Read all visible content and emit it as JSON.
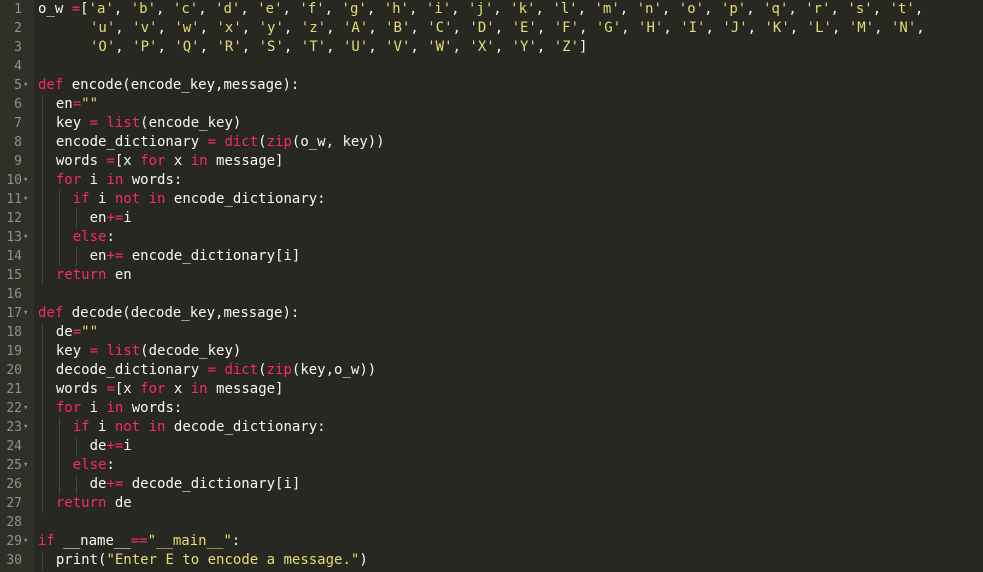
{
  "editor": {
    "theme": "monokai",
    "colors": {
      "background": "#272822",
      "gutter": "#2f3129",
      "line_number": "#8f908a",
      "text": "#f8f8f2",
      "keyword": "#f92672",
      "string": "#e6db74"
    },
    "lines": [
      {
        "n": "1",
        "fold": false,
        "indent": 0,
        "tokens": [
          [
            "o_w ",
            "plain"
          ],
          [
            "=",
            "op"
          ],
          [
            "[",
            "plain"
          ],
          [
            "'a'",
            "str"
          ],
          [
            ", ",
            "plain"
          ],
          [
            "'b'",
            "str"
          ],
          [
            ", ",
            "plain"
          ],
          [
            "'c'",
            "str"
          ],
          [
            ", ",
            "plain"
          ],
          [
            "'d'",
            "str"
          ],
          [
            ", ",
            "plain"
          ],
          [
            "'e'",
            "str"
          ],
          [
            ", ",
            "plain"
          ],
          [
            "'f'",
            "str"
          ],
          [
            ", ",
            "plain"
          ],
          [
            "'g'",
            "str"
          ],
          [
            ", ",
            "plain"
          ],
          [
            "'h'",
            "str"
          ],
          [
            ", ",
            "plain"
          ],
          [
            "'i'",
            "str"
          ],
          [
            ", ",
            "plain"
          ],
          [
            "'j'",
            "str"
          ],
          [
            ", ",
            "plain"
          ],
          [
            "'k'",
            "str"
          ],
          [
            ", ",
            "plain"
          ],
          [
            "'l'",
            "str"
          ],
          [
            ", ",
            "plain"
          ],
          [
            "'m'",
            "str"
          ],
          [
            ", ",
            "plain"
          ],
          [
            "'n'",
            "str"
          ],
          [
            ", ",
            "plain"
          ],
          [
            "'o'",
            "str"
          ],
          [
            ", ",
            "plain"
          ],
          [
            "'p'",
            "str"
          ],
          [
            ", ",
            "plain"
          ],
          [
            "'q'",
            "str"
          ],
          [
            ", ",
            "plain"
          ],
          [
            "'r'",
            "str"
          ],
          [
            ", ",
            "plain"
          ],
          [
            "'s'",
            "str"
          ],
          [
            ", ",
            "plain"
          ],
          [
            "'t'",
            "str"
          ],
          [
            ",",
            "plain"
          ]
        ]
      },
      {
        "n": "2",
        "fold": false,
        "indent": 3,
        "tokens": [
          [
            "'u'",
            "str"
          ],
          [
            ", ",
            "plain"
          ],
          [
            "'v'",
            "str"
          ],
          [
            ", ",
            "plain"
          ],
          [
            "'w'",
            "str"
          ],
          [
            ", ",
            "plain"
          ],
          [
            "'x'",
            "str"
          ],
          [
            ", ",
            "plain"
          ],
          [
            "'y'",
            "str"
          ],
          [
            ", ",
            "plain"
          ],
          [
            "'z'",
            "str"
          ],
          [
            ", ",
            "plain"
          ],
          [
            "'A'",
            "str"
          ],
          [
            ", ",
            "plain"
          ],
          [
            "'B'",
            "str"
          ],
          [
            ", ",
            "plain"
          ],
          [
            "'C'",
            "str"
          ],
          [
            ", ",
            "plain"
          ],
          [
            "'D'",
            "str"
          ],
          [
            ", ",
            "plain"
          ],
          [
            "'E'",
            "str"
          ],
          [
            ", ",
            "plain"
          ],
          [
            "'F'",
            "str"
          ],
          [
            ", ",
            "plain"
          ],
          [
            "'G'",
            "str"
          ],
          [
            ", ",
            "plain"
          ],
          [
            "'H'",
            "str"
          ],
          [
            ", ",
            "plain"
          ],
          [
            "'I'",
            "str"
          ],
          [
            ", ",
            "plain"
          ],
          [
            "'J'",
            "str"
          ],
          [
            ", ",
            "plain"
          ],
          [
            "'K'",
            "str"
          ],
          [
            ", ",
            "plain"
          ],
          [
            "'L'",
            "str"
          ],
          [
            ", ",
            "plain"
          ],
          [
            "'M'",
            "str"
          ],
          [
            ", ",
            "plain"
          ],
          [
            "'N'",
            "str"
          ],
          [
            ",",
            "plain"
          ]
        ]
      },
      {
        "n": "3",
        "fold": false,
        "indent": 3,
        "tokens": [
          [
            "'O'",
            "str"
          ],
          [
            ", ",
            "plain"
          ],
          [
            "'P'",
            "str"
          ],
          [
            ", ",
            "plain"
          ],
          [
            "'Q'",
            "str"
          ],
          [
            ", ",
            "plain"
          ],
          [
            "'R'",
            "str"
          ],
          [
            ", ",
            "plain"
          ],
          [
            "'S'",
            "str"
          ],
          [
            ", ",
            "plain"
          ],
          [
            "'T'",
            "str"
          ],
          [
            ", ",
            "plain"
          ],
          [
            "'U'",
            "str"
          ],
          [
            ", ",
            "plain"
          ],
          [
            "'V'",
            "str"
          ],
          [
            ", ",
            "plain"
          ],
          [
            "'W'",
            "str"
          ],
          [
            ", ",
            "plain"
          ],
          [
            "'X'",
            "str"
          ],
          [
            ", ",
            "plain"
          ],
          [
            "'Y'",
            "str"
          ],
          [
            ", ",
            "plain"
          ],
          [
            "'Z'",
            "str"
          ],
          [
            "]",
            "plain"
          ]
        ]
      },
      {
        "n": "4",
        "fold": false,
        "indent": 0,
        "tokens": []
      },
      {
        "n": "5",
        "fold": true,
        "indent": 0,
        "tokens": [
          [
            "def ",
            "kw"
          ],
          [
            "encode",
            "plain"
          ],
          [
            "(",
            "plain"
          ],
          [
            "encode_key",
            "plain"
          ],
          [
            ",",
            "plain"
          ],
          [
            "message",
            "plain"
          ],
          [
            "):",
            "plain"
          ]
        ]
      },
      {
        "n": "6",
        "fold": false,
        "indent": 1,
        "tokens": [
          [
            "en",
            "plain"
          ],
          [
            "=",
            "op"
          ],
          [
            "\"\"",
            "str"
          ]
        ]
      },
      {
        "n": "7",
        "fold": false,
        "indent": 1,
        "tokens": [
          [
            "key ",
            "plain"
          ],
          [
            "= ",
            "op"
          ],
          [
            "list",
            "kw"
          ],
          [
            "(encode_key)",
            "plain"
          ]
        ]
      },
      {
        "n": "8",
        "fold": false,
        "indent": 1,
        "tokens": [
          [
            "encode_dictionary ",
            "plain"
          ],
          [
            "= ",
            "op"
          ],
          [
            "dict",
            "kw"
          ],
          [
            "(",
            "plain"
          ],
          [
            "zip",
            "kw"
          ],
          [
            "(o_w, key))",
            "plain"
          ]
        ]
      },
      {
        "n": "9",
        "fold": false,
        "indent": 1,
        "tokens": [
          [
            "words ",
            "plain"
          ],
          [
            "=",
            "op"
          ],
          [
            "[x ",
            "plain"
          ],
          [
            "for ",
            "kw"
          ],
          [
            "x ",
            "plain"
          ],
          [
            "in ",
            "kw"
          ],
          [
            "message]",
            "plain"
          ]
        ]
      },
      {
        "n": "10",
        "fold": true,
        "indent": 1,
        "tokens": [
          [
            "for ",
            "kw"
          ],
          [
            "i ",
            "plain"
          ],
          [
            "in ",
            "kw"
          ],
          [
            "words:",
            "plain"
          ]
        ]
      },
      {
        "n": "11",
        "fold": true,
        "indent": 2,
        "tokens": [
          [
            "if ",
            "kw"
          ],
          [
            "i ",
            "plain"
          ],
          [
            "not ",
            "kw"
          ],
          [
            "in ",
            "kw"
          ],
          [
            "encode_dictionary:",
            "plain"
          ]
        ]
      },
      {
        "n": "12",
        "fold": false,
        "indent": 3,
        "tokens": [
          [
            "en",
            "plain"
          ],
          [
            "+=",
            "op"
          ],
          [
            "i",
            "plain"
          ]
        ]
      },
      {
        "n": "13",
        "fold": true,
        "indent": 2,
        "tokens": [
          [
            "else",
            "kw"
          ],
          [
            ":",
            "plain"
          ]
        ]
      },
      {
        "n": "14",
        "fold": false,
        "indent": 3,
        "tokens": [
          [
            "en",
            "plain"
          ],
          [
            "+= ",
            "op"
          ],
          [
            "encode_dictionary[i]",
            "plain"
          ]
        ]
      },
      {
        "n": "15",
        "fold": false,
        "indent": 1,
        "tokens": [
          [
            "return ",
            "kw"
          ],
          [
            "en",
            "plain"
          ]
        ]
      },
      {
        "n": "16",
        "fold": false,
        "indent": 0,
        "tokens": []
      },
      {
        "n": "17",
        "fold": true,
        "indent": 0,
        "tokens": [
          [
            "def ",
            "kw"
          ],
          [
            "decode",
            "plain"
          ],
          [
            "(",
            "plain"
          ],
          [
            "decode_key",
            "plain"
          ],
          [
            ",",
            "plain"
          ],
          [
            "message",
            "plain"
          ],
          [
            "):",
            "plain"
          ]
        ]
      },
      {
        "n": "18",
        "fold": false,
        "indent": 1,
        "tokens": [
          [
            "de",
            "plain"
          ],
          [
            "=",
            "op"
          ],
          [
            "\"\"",
            "str"
          ]
        ]
      },
      {
        "n": "19",
        "fold": false,
        "indent": 1,
        "tokens": [
          [
            "key ",
            "plain"
          ],
          [
            "= ",
            "op"
          ],
          [
            "list",
            "kw"
          ],
          [
            "(decode_key)",
            "plain"
          ]
        ]
      },
      {
        "n": "20",
        "fold": false,
        "indent": 1,
        "tokens": [
          [
            "decode_dictionary ",
            "plain"
          ],
          [
            "= ",
            "op"
          ],
          [
            "dict",
            "kw"
          ],
          [
            "(",
            "plain"
          ],
          [
            "zip",
            "kw"
          ],
          [
            "(key,o_w))",
            "plain"
          ]
        ]
      },
      {
        "n": "21",
        "fold": false,
        "indent": 1,
        "tokens": [
          [
            "words ",
            "plain"
          ],
          [
            "=",
            "op"
          ],
          [
            "[x ",
            "plain"
          ],
          [
            "for ",
            "kw"
          ],
          [
            "x ",
            "plain"
          ],
          [
            "in ",
            "kw"
          ],
          [
            "message]",
            "plain"
          ]
        ]
      },
      {
        "n": "22",
        "fold": true,
        "indent": 1,
        "tokens": [
          [
            "for ",
            "kw"
          ],
          [
            "i ",
            "plain"
          ],
          [
            "in ",
            "kw"
          ],
          [
            "words:",
            "plain"
          ]
        ]
      },
      {
        "n": "23",
        "fold": true,
        "indent": 2,
        "tokens": [
          [
            "if ",
            "kw"
          ],
          [
            "i ",
            "plain"
          ],
          [
            "not ",
            "kw"
          ],
          [
            "in ",
            "kw"
          ],
          [
            "decode_dictionary:",
            "plain"
          ]
        ]
      },
      {
        "n": "24",
        "fold": false,
        "indent": 3,
        "tokens": [
          [
            "de",
            "plain"
          ],
          [
            "+=",
            "op"
          ],
          [
            "i",
            "plain"
          ]
        ]
      },
      {
        "n": "25",
        "fold": true,
        "indent": 2,
        "tokens": [
          [
            "else",
            "kw"
          ],
          [
            ":",
            "plain"
          ]
        ]
      },
      {
        "n": "26",
        "fold": false,
        "indent": 3,
        "tokens": [
          [
            "de",
            "plain"
          ],
          [
            "+= ",
            "op"
          ],
          [
            "decode_dictionary[i]",
            "plain"
          ]
        ]
      },
      {
        "n": "27",
        "fold": false,
        "indent": 1,
        "tokens": [
          [
            "return ",
            "kw"
          ],
          [
            "de",
            "plain"
          ]
        ]
      },
      {
        "n": "28",
        "fold": false,
        "indent": 0,
        "tokens": []
      },
      {
        "n": "29",
        "fold": true,
        "indent": 0,
        "tokens": [
          [
            "if ",
            "kw"
          ],
          [
            "__name__",
            "plain"
          ],
          [
            "==",
            "op"
          ],
          [
            "\"__main__\"",
            "str"
          ],
          [
            ":",
            "plain"
          ]
        ]
      },
      {
        "n": "30",
        "fold": false,
        "indent": 1,
        "tokens": [
          [
            "print",
            "plain"
          ],
          [
            "(",
            "plain"
          ],
          [
            "\"Enter E to encode a message.\"",
            "str"
          ],
          [
            ")",
            "plain"
          ]
        ]
      }
    ]
  }
}
